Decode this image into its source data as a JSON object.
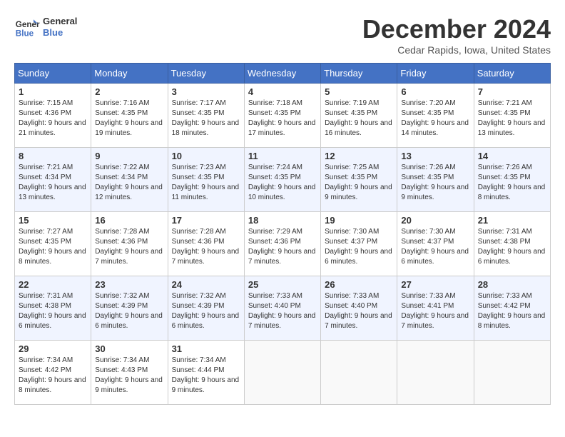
{
  "logo": {
    "line1": "General",
    "line2": "Blue"
  },
  "title": "December 2024",
  "location": "Cedar Rapids, Iowa, United States",
  "weekdays": [
    "Sunday",
    "Monday",
    "Tuesday",
    "Wednesday",
    "Thursday",
    "Friday",
    "Saturday"
  ],
  "weeks": [
    [
      {
        "day": "1",
        "sunrise": "7:15 AM",
        "sunset": "4:36 PM",
        "daylight": "9 hours and 21 minutes."
      },
      {
        "day": "2",
        "sunrise": "7:16 AM",
        "sunset": "4:35 PM",
        "daylight": "9 hours and 19 minutes."
      },
      {
        "day": "3",
        "sunrise": "7:17 AM",
        "sunset": "4:35 PM",
        "daylight": "9 hours and 18 minutes."
      },
      {
        "day": "4",
        "sunrise": "7:18 AM",
        "sunset": "4:35 PM",
        "daylight": "9 hours and 17 minutes."
      },
      {
        "day": "5",
        "sunrise": "7:19 AM",
        "sunset": "4:35 PM",
        "daylight": "9 hours and 16 minutes."
      },
      {
        "day": "6",
        "sunrise": "7:20 AM",
        "sunset": "4:35 PM",
        "daylight": "9 hours and 14 minutes."
      },
      {
        "day": "7",
        "sunrise": "7:21 AM",
        "sunset": "4:35 PM",
        "daylight": "9 hours and 13 minutes."
      }
    ],
    [
      {
        "day": "8",
        "sunrise": "7:21 AM",
        "sunset": "4:34 PM",
        "daylight": "9 hours and 13 minutes."
      },
      {
        "day": "9",
        "sunrise": "7:22 AM",
        "sunset": "4:34 PM",
        "daylight": "9 hours and 12 minutes."
      },
      {
        "day": "10",
        "sunrise": "7:23 AM",
        "sunset": "4:35 PM",
        "daylight": "9 hours and 11 minutes."
      },
      {
        "day": "11",
        "sunrise": "7:24 AM",
        "sunset": "4:35 PM",
        "daylight": "9 hours and 10 minutes."
      },
      {
        "day": "12",
        "sunrise": "7:25 AM",
        "sunset": "4:35 PM",
        "daylight": "9 hours and 9 minutes."
      },
      {
        "day": "13",
        "sunrise": "7:26 AM",
        "sunset": "4:35 PM",
        "daylight": "9 hours and 9 minutes."
      },
      {
        "day": "14",
        "sunrise": "7:26 AM",
        "sunset": "4:35 PM",
        "daylight": "9 hours and 8 minutes."
      }
    ],
    [
      {
        "day": "15",
        "sunrise": "7:27 AM",
        "sunset": "4:35 PM",
        "daylight": "9 hours and 8 minutes."
      },
      {
        "day": "16",
        "sunrise": "7:28 AM",
        "sunset": "4:36 PM",
        "daylight": "9 hours and 7 minutes."
      },
      {
        "day": "17",
        "sunrise": "7:28 AM",
        "sunset": "4:36 PM",
        "daylight": "9 hours and 7 minutes."
      },
      {
        "day": "18",
        "sunrise": "7:29 AM",
        "sunset": "4:36 PM",
        "daylight": "9 hours and 7 minutes."
      },
      {
        "day": "19",
        "sunrise": "7:30 AM",
        "sunset": "4:37 PM",
        "daylight": "9 hours and 6 minutes."
      },
      {
        "day": "20",
        "sunrise": "7:30 AM",
        "sunset": "4:37 PM",
        "daylight": "9 hours and 6 minutes."
      },
      {
        "day": "21",
        "sunrise": "7:31 AM",
        "sunset": "4:38 PM",
        "daylight": "9 hours and 6 minutes."
      }
    ],
    [
      {
        "day": "22",
        "sunrise": "7:31 AM",
        "sunset": "4:38 PM",
        "daylight": "9 hours and 6 minutes."
      },
      {
        "day": "23",
        "sunrise": "7:32 AM",
        "sunset": "4:39 PM",
        "daylight": "9 hours and 6 minutes."
      },
      {
        "day": "24",
        "sunrise": "7:32 AM",
        "sunset": "4:39 PM",
        "daylight": "9 hours and 6 minutes."
      },
      {
        "day": "25",
        "sunrise": "7:33 AM",
        "sunset": "4:40 PM",
        "daylight": "9 hours and 7 minutes."
      },
      {
        "day": "26",
        "sunrise": "7:33 AM",
        "sunset": "4:40 PM",
        "daylight": "9 hours and 7 minutes."
      },
      {
        "day": "27",
        "sunrise": "7:33 AM",
        "sunset": "4:41 PM",
        "daylight": "9 hours and 7 minutes."
      },
      {
        "day": "28",
        "sunrise": "7:33 AM",
        "sunset": "4:42 PM",
        "daylight": "9 hours and 8 minutes."
      }
    ],
    [
      {
        "day": "29",
        "sunrise": "7:34 AM",
        "sunset": "4:42 PM",
        "daylight": "9 hours and 8 minutes."
      },
      {
        "day": "30",
        "sunrise": "7:34 AM",
        "sunset": "4:43 PM",
        "daylight": "9 hours and 9 minutes."
      },
      {
        "day": "31",
        "sunrise": "7:34 AM",
        "sunset": "4:44 PM",
        "daylight": "9 hours and 9 minutes."
      },
      null,
      null,
      null,
      null
    ]
  ]
}
